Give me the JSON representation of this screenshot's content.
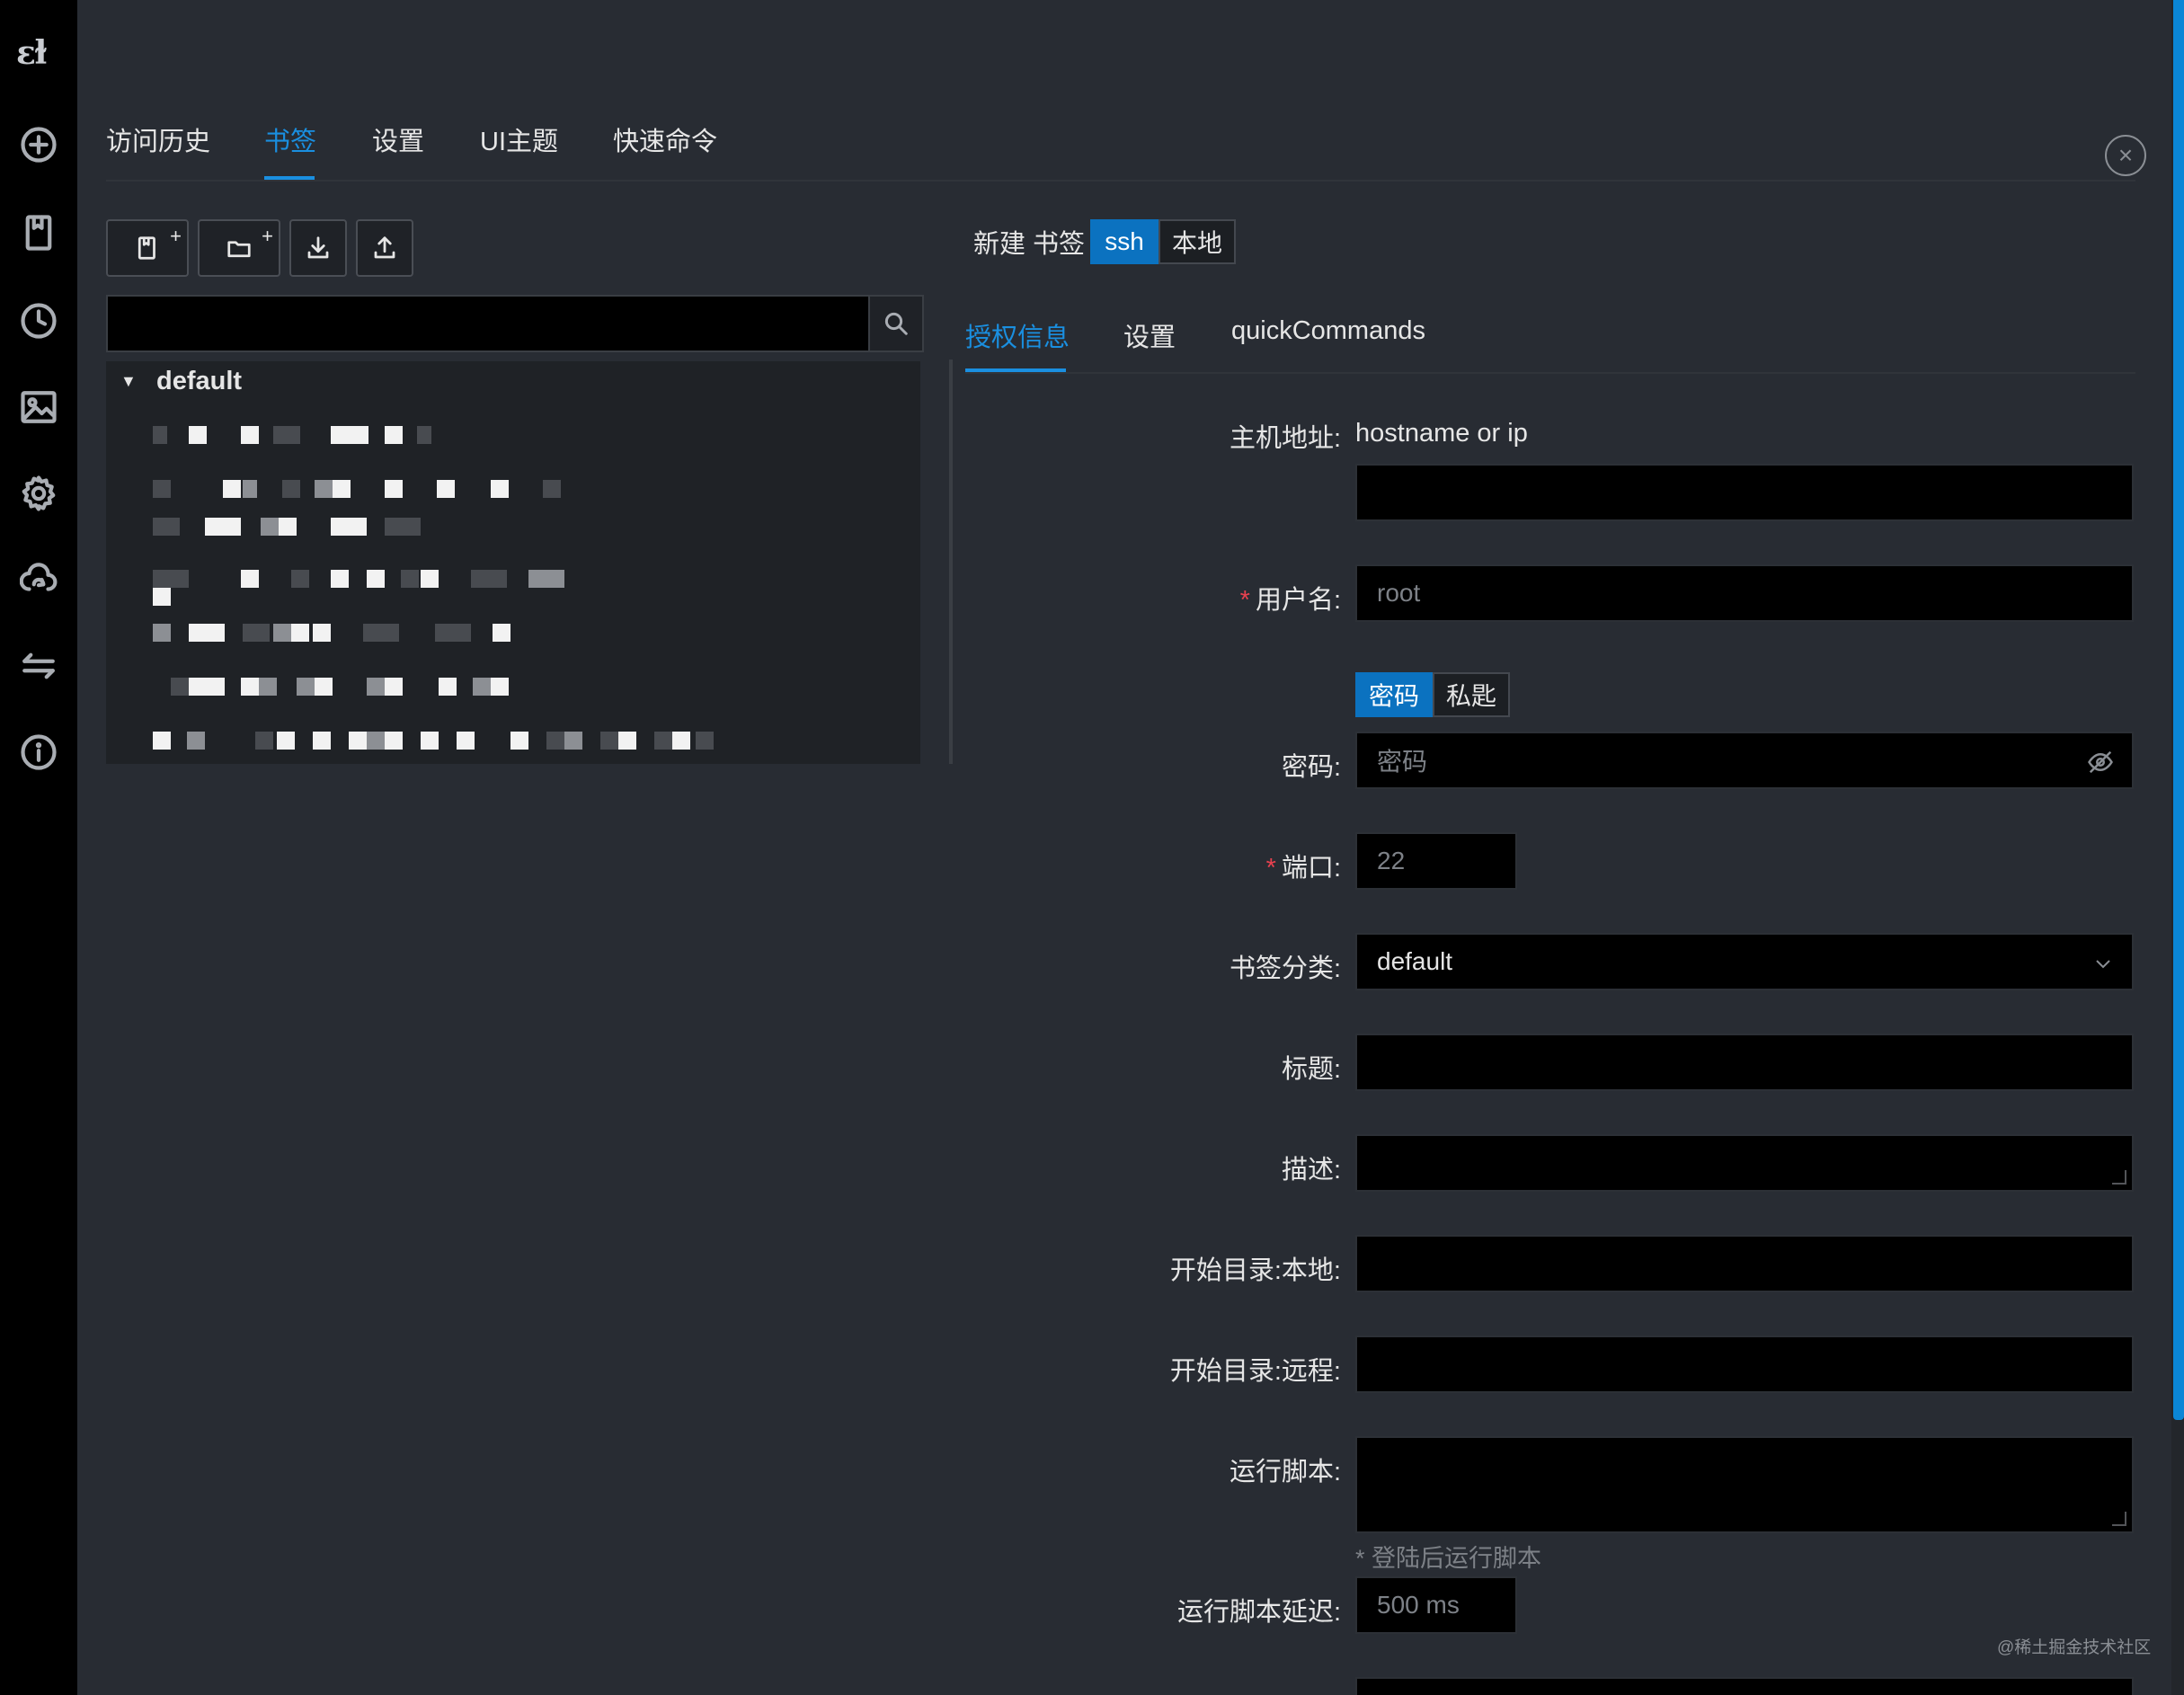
{
  "rail": {
    "logo": "ɛɫ",
    "icons": [
      "add-circle-icon",
      "bookmark-icon",
      "history-clock-icon",
      "image-icon",
      "settings-gear-icon",
      "cloud-sync-icon",
      "transfer-arrows-icon",
      "info-icon"
    ]
  },
  "top_tabs": [
    {
      "label": "访问历史",
      "active": false
    },
    {
      "label": "书签",
      "active": true
    },
    {
      "label": "设置",
      "active": false
    },
    {
      "label": "UI主题",
      "active": false
    },
    {
      "label": "快速命令",
      "active": false
    }
  ],
  "close_symbol": "×",
  "toolbar": {
    "new_bookmark_plus": "+",
    "new_folder_plus": "+"
  },
  "search": {
    "placeholder": "",
    "value": ""
  },
  "tree": {
    "root_label": "default",
    "caret": "▼"
  },
  "form": {
    "new_bookmark_label": "新建 书签",
    "type_options": [
      {
        "label": "ssh",
        "active": true
      },
      {
        "label": "本地",
        "active": false
      }
    ],
    "sub_tabs": [
      {
        "label": "授权信息",
        "active": true
      },
      {
        "label": "设置",
        "active": false
      },
      {
        "label": "quickCommands",
        "active": false
      }
    ],
    "host_label": "主机地址:",
    "host_hint": "hostname or ip",
    "host_value": "",
    "username_label": "用户名:",
    "username_value": "root",
    "auth_options": [
      {
        "label": "密码",
        "active": true
      },
      {
        "label": "私匙",
        "active": false
      }
    ],
    "password_label": "密码:",
    "password_placeholder": "密码",
    "port_label": "端口:",
    "port_value": "22",
    "category_label": "书签分类:",
    "category_value": "default",
    "title_label": "标题:",
    "desc_label": "描述:",
    "start_local_label": "开始目录:本地:",
    "start_remote_label": "开始目录:远程:",
    "script_label": "运行脚本:",
    "script_hint": "* 登陆后运行脚本",
    "script_delay_label": "运行脚本延迟:",
    "script_delay_value": "500 ms",
    "required_mark": "*"
  },
  "watermark": "@稀土掘金技术社区",
  "colors": {
    "accent": "#1a8fe0",
    "active_segment": "#0b72c0",
    "required": "#e8414f",
    "background": "#282c33",
    "rail": "#000000"
  }
}
